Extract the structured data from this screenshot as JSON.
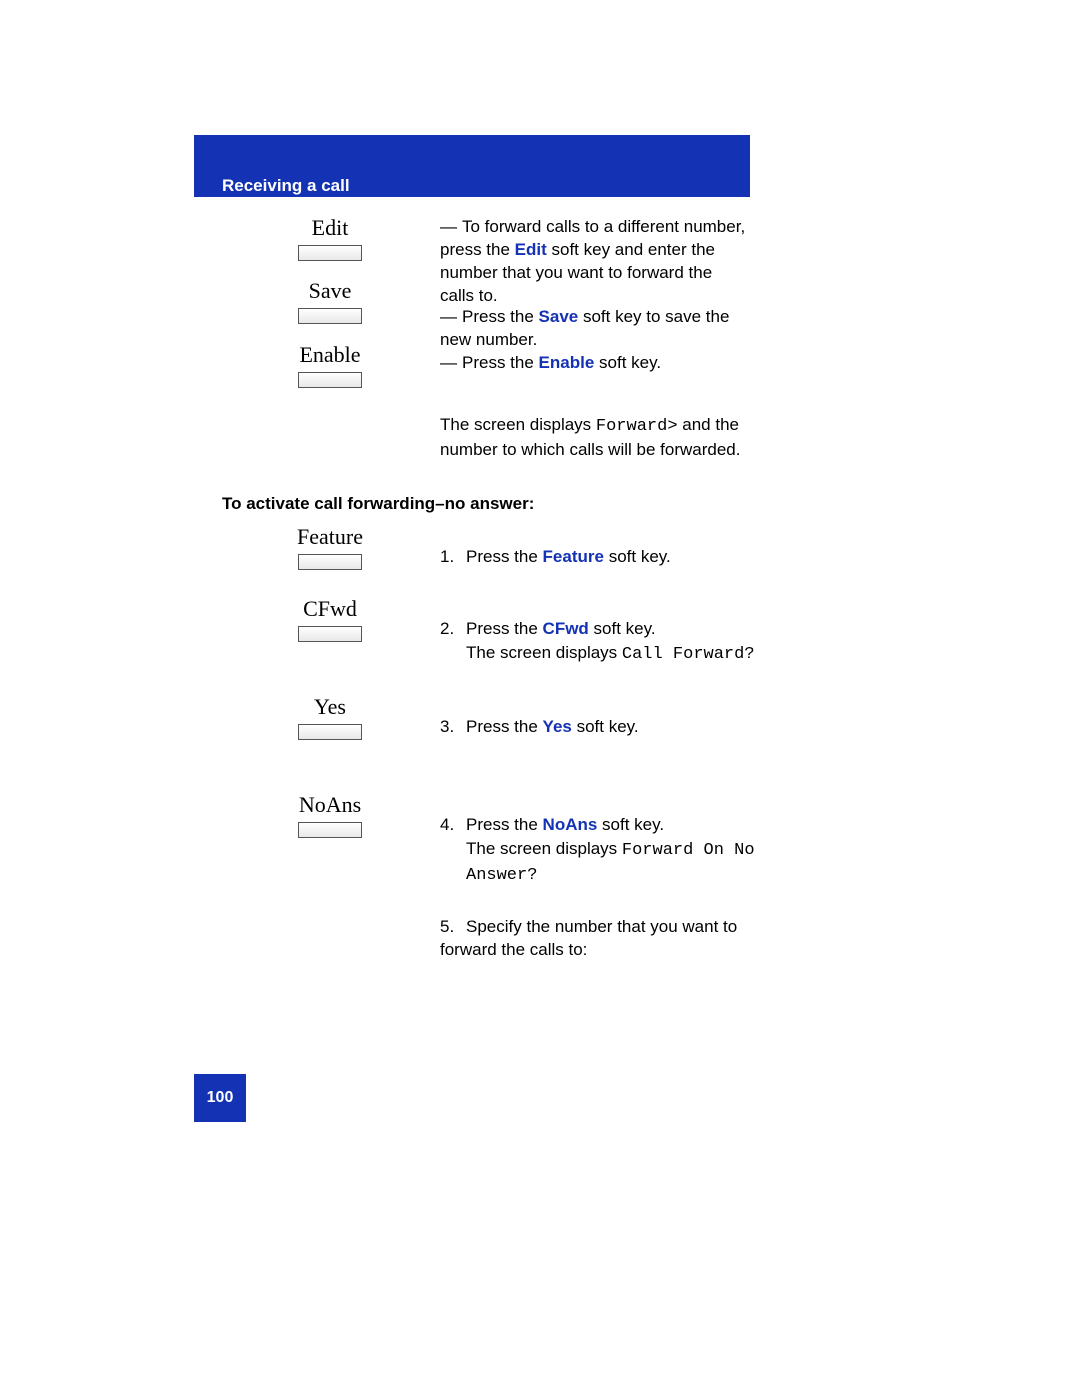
{
  "header": {
    "title": "Receiving a call"
  },
  "topKeys": {
    "edit": "Edit",
    "save": "Save",
    "enable": "Enable"
  },
  "topBullets": {
    "b1_pre": "To forward calls to a different number, press the ",
    "b1_key": "Edit",
    "b1_post": " soft key and enter the number that you want to forward the calls to.",
    "b2_pre": "Press the ",
    "b2_key": "Save",
    "b2_post": " soft key to save the new number.",
    "b3_pre": "Press the ",
    "b3_key": "Enable",
    "b3_post": " soft key."
  },
  "screenNote": {
    "pre": "The screen displays ",
    "code": "Forward>",
    "post": " and the number to which calls will be forwarded."
  },
  "sectionTitle": "To activate call forwarding–no answer:",
  "steps": {
    "feature": {
      "label": "Feature",
      "num": "1.",
      "pre": "Press the ",
      "key": "Feature",
      "post": " soft key."
    },
    "cfwd": {
      "label": "CFwd",
      "num": "2.",
      "pre": "Press the ",
      "key": "CFwd",
      "post": " soft key.",
      "screenPre": "The screen displays ",
      "screenCode": "Call Forward?"
    },
    "yes": {
      "label": "Yes",
      "num": "3.",
      "pre": "Press the ",
      "key": "Yes",
      "post": " soft key."
    },
    "noans": {
      "label": "NoAns",
      "num": "4.",
      "pre": "Press the ",
      "key": "NoAns",
      "post": " soft key.",
      "screenPre": "The screen displays ",
      "screenCode": "Forward On No Answer?"
    },
    "step5": {
      "num": "5.",
      "text": "Specify the number that you want to forward the calls to:"
    }
  },
  "footer": {
    "page": "100"
  }
}
